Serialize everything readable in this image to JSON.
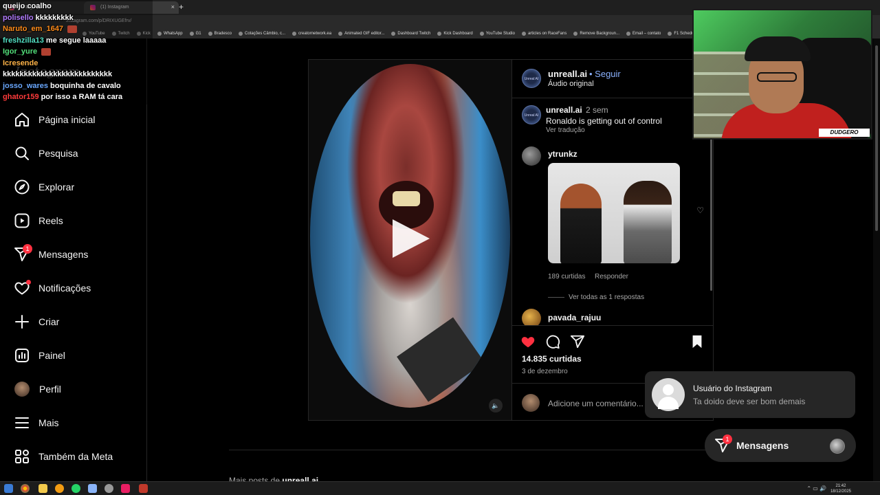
{
  "browser": {
    "tabs": [
      {
        "label": "Instagram",
        "active": false
      },
      {
        "label": "(1) Instagram",
        "active": true
      }
    ],
    "url": "instagram.com/p/DRIXUGEfrv/",
    "bookmarks": [
      "YouTube",
      "Twitch",
      "Kick",
      "WhatsApp",
      "G1",
      "Bradesco",
      "Cotações Câmbio, c...",
      "creatornetwork.ea",
      "Animated GIF editor...",
      "Dashboard Twitch",
      "Kick Dashboard",
      "YouTube Studio",
      "articles on RaceFans",
      "Remove Backgroun...",
      "Email – contato",
      "F1 Schedule 2026",
      "NFS"
    ]
  },
  "sidebar": {
    "logo": "Instagram",
    "items": [
      {
        "label": "Página inicial",
        "icon": "home-icon"
      },
      {
        "label": "Pesquisa",
        "icon": "search-icon"
      },
      {
        "label": "Explorar",
        "icon": "compass-icon"
      },
      {
        "label": "Reels",
        "icon": "reels-icon"
      },
      {
        "label": "Mensagens",
        "icon": "messenger-icon",
        "badge": "1"
      },
      {
        "label": "Notificações",
        "icon": "heart-icon",
        "dot": true
      },
      {
        "label": "Criar",
        "icon": "plus-icon"
      },
      {
        "label": "Painel",
        "icon": "dashboard-icon"
      },
      {
        "label": "Perfil",
        "icon": "avatar"
      },
      {
        "label": "Mais",
        "icon": "menu-icon"
      },
      {
        "label": "Também da Meta",
        "icon": "meta-apps-icon"
      }
    ]
  },
  "post": {
    "author": "unreall.ai",
    "avatar_text": "Unreal AI",
    "follow": "• Seguir",
    "audio": "Áudio original",
    "caption": {
      "author": "unreall.ai",
      "time": "2 sem",
      "text": "Ronaldo is getting out of control",
      "translate": "Ver tradução"
    },
    "comments": [
      {
        "user": "ytrunkz",
        "likes": "189 curtidas",
        "reply": "Responder",
        "view_replies": "Ver todas as 1 respostas"
      },
      {
        "user": "pavada_rajuu"
      }
    ],
    "likes": "14.835 curtidas",
    "date": "3 de dezembro",
    "add_comment_placeholder": "Adicione um comentário..."
  },
  "more_posts": {
    "prefix": "Mais posts de",
    "user": "unreall.ai"
  },
  "notification": {
    "title": "Usuário do Instagram",
    "text": "Ta doido deve ser bom demais"
  },
  "messages_pill": {
    "label": "Mensagens",
    "badge": "1"
  },
  "chat": [
    {
      "user": "queijo coalho",
      "msg": "",
      "color": "#ffffff"
    },
    {
      "user": "polisello",
      "msg": "kkkkkkkkk",
      "color": "#b37cff"
    },
    {
      "user": "Naruto_em_1647",
      "msg": "",
      "color": "#ff8c1a",
      "emote": true
    },
    {
      "user": "freshzilla13",
      "msg": "me segue laaaaa",
      "color": "#52e0c4"
    },
    {
      "user": "Igor_yure",
      "msg": "",
      "color": "#52e07a",
      "emote": true
    },
    {
      "user": "Icresende",
      "msg": "",
      "color": "#ffb347"
    },
    {
      "user": "",
      "msg": "kkkkkkkkkkkkkkkkkkkkkkkkkk",
      "color": "#ffffff"
    },
    {
      "user": "josso_wares",
      "msg": "boquinha de cavalo",
      "color": "#6aa8ff"
    },
    {
      "user": "ghator159",
      "msg": "por isso a RAM tá cara",
      "color": "#ff3b3b"
    }
  ],
  "webcam_tag": "DUDGERO",
  "taskbar": {
    "time": "21:42",
    "date": "18/12/2025"
  }
}
